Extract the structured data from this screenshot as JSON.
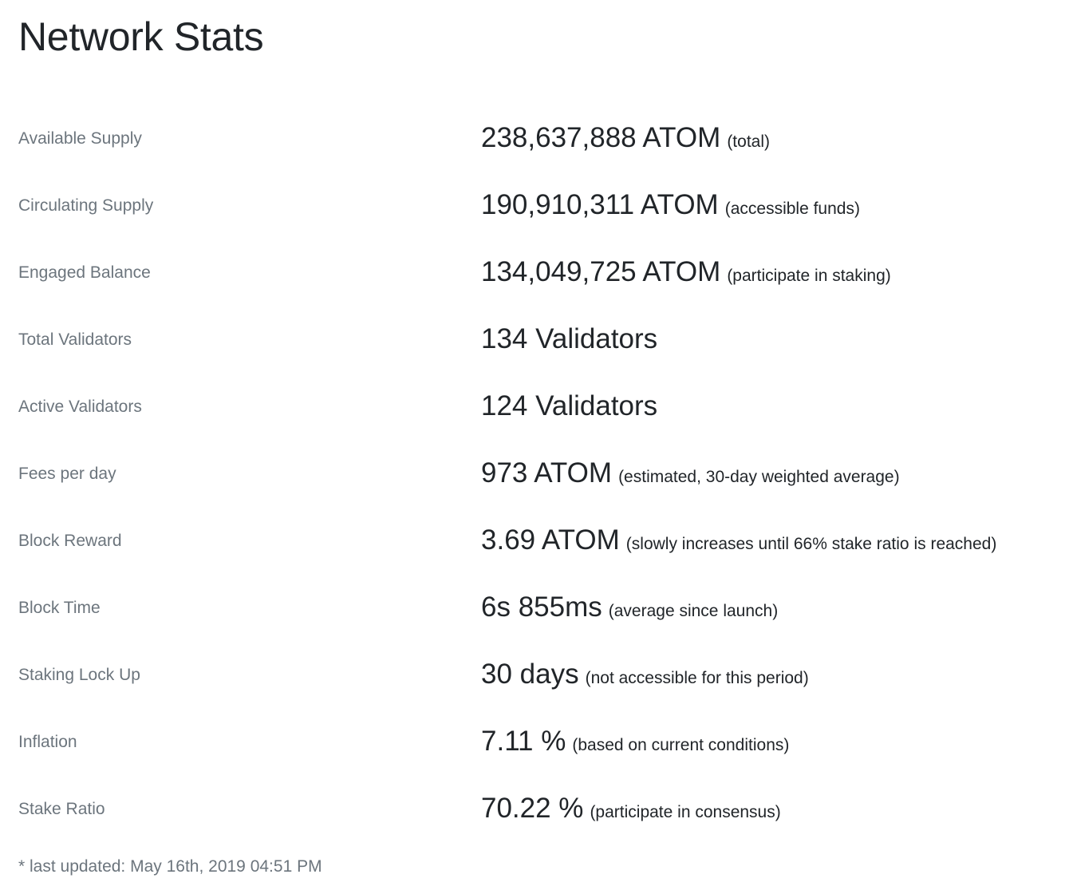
{
  "page": {
    "title": "Network Stats"
  },
  "stats": [
    {
      "label": "Available Supply",
      "value": "238,637,888 ATOM",
      "note": "(total)"
    },
    {
      "label": "Circulating Supply",
      "value": "190,910,311 ATOM",
      "note": "(accessible funds)"
    },
    {
      "label": "Engaged Balance",
      "value": "134,049,725 ATOM",
      "note": "(participate in staking)"
    },
    {
      "label": "Total Validators",
      "value": "134 Validators",
      "note": ""
    },
    {
      "label": "Active Validators",
      "value": "124 Validators",
      "note": ""
    },
    {
      "label": "Fees per day",
      "value": "973 ATOM",
      "note": "(estimated, 30-day weighted average)"
    },
    {
      "label": "Block Reward",
      "value": "3.69 ATOM",
      "note": "(slowly increases until 66% stake ratio is reached)"
    },
    {
      "label": "Block Time",
      "value": "6s 855ms",
      "note": "(average since launch)"
    },
    {
      "label": "Staking Lock Up",
      "value": "30 days",
      "note": "(not accessible for this period)"
    },
    {
      "label": "Inflation",
      "value": "7.11 %",
      "note": "(based on current conditions)"
    },
    {
      "label": "Stake Ratio",
      "value": "70.22 %",
      "note": "(participate in consensus)"
    }
  ],
  "footer": {
    "last_updated": "* last updated: May 16th, 2019 04:51 PM"
  }
}
